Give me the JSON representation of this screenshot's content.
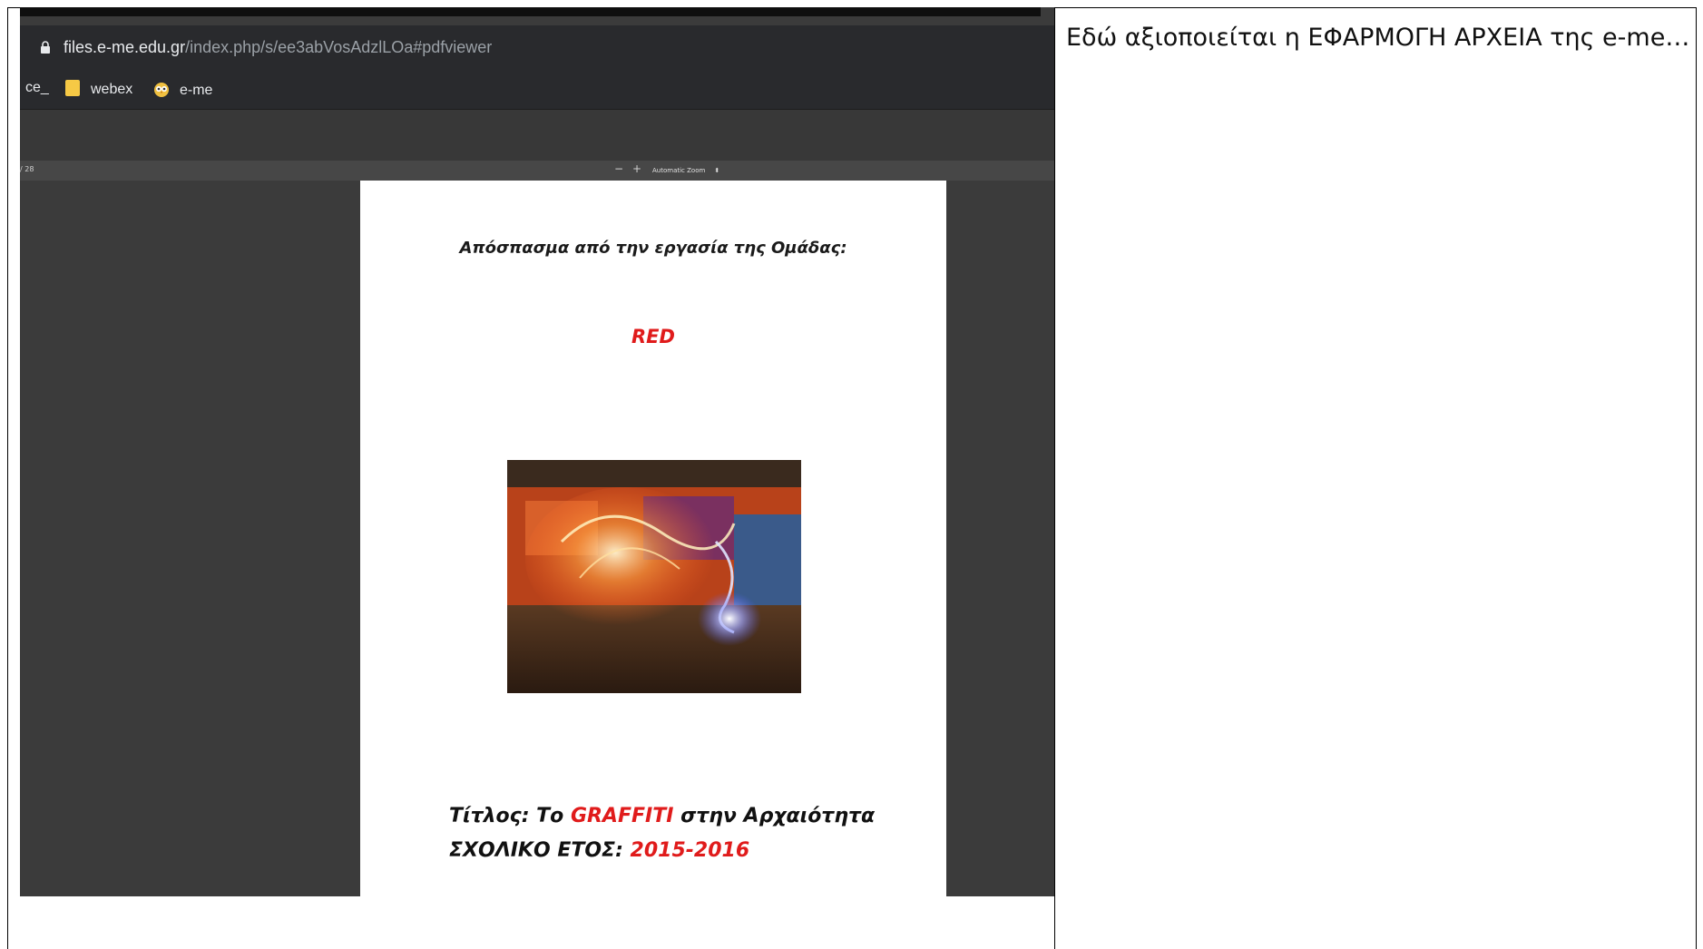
{
  "browser": {
    "url_host": "files.e-me.edu.gr",
    "url_path": "/index.php/s/ee3abVosAdzlLOa#pdfviewer",
    "bookmarks": [
      "ce_",
      "webex",
      "e-me"
    ]
  },
  "pdf_viewer": {
    "page_count": "/ 28",
    "zoom_out": "−",
    "zoom_in": "+",
    "zoom_level": "Automatic Zoom"
  },
  "pdf_page": {
    "excerpt_heading": "Απόσπασμα από την εργασία της Ομάδας:",
    "group_name": "RED",
    "title_label": "Τίτλος: Το ",
    "title_highlight": "GRAFFITI",
    "title_rest": " στην Αρχαιότητα",
    "year_label": "ΣΧΟΛΙΚΟ ΕΤΟΣ: ",
    "year_value": "2015-2016"
  },
  "caption": "Εδώ αξιοποιείται η ΕΦΑΡΜΟΓΗ ΑΡΧΕΙΑ της e-me…",
  "colors": {
    "accent_red": "#e01b1b",
    "viewer_bg": "#3b3b3b",
    "browser_chrome": "#292a2d"
  }
}
